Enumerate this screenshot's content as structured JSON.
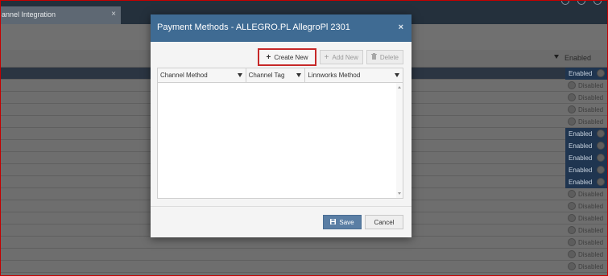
{
  "app": {
    "tab_label": "annel Integration",
    "tab_close": "×"
  },
  "background": {
    "enabled_header": "Enabled",
    "rows": [
      {
        "status": "Enabled",
        "on": true,
        "highlight": true
      },
      {
        "status": "Disabled",
        "on": false,
        "highlight": false
      },
      {
        "status": "Disabled",
        "on": false,
        "highlight": false
      },
      {
        "status": "Disabled",
        "on": false,
        "highlight": false
      },
      {
        "status": "Disabled",
        "on": false,
        "highlight": false
      },
      {
        "status": "Enabled",
        "on": true,
        "highlight": false
      },
      {
        "status": "Enabled",
        "on": true,
        "highlight": false
      },
      {
        "status": "Enabled",
        "on": true,
        "highlight": false
      },
      {
        "status": "Enabled",
        "on": true,
        "highlight": false
      },
      {
        "status": "Enabled",
        "on": true,
        "highlight": false
      },
      {
        "status": "Disabled",
        "on": false,
        "highlight": false
      },
      {
        "status": "Disabled",
        "on": false,
        "highlight": false
      },
      {
        "status": "Disabled",
        "on": false,
        "highlight": false
      },
      {
        "status": "Disabled",
        "on": false,
        "highlight": false
      },
      {
        "status": "Disabled",
        "on": false,
        "highlight": false
      },
      {
        "status": "Disabled",
        "on": false,
        "highlight": false
      },
      {
        "status": "Disabled",
        "on": false,
        "highlight": false
      }
    ]
  },
  "modal": {
    "title": "Payment Methods - ALLEGRO.PL AllegroPl 2301",
    "close": "×",
    "toolbar": {
      "create_new": "Create New",
      "add_new": "Add New",
      "delete": "Delete"
    },
    "grid": {
      "columns": [
        "Channel Method",
        "Channel Tag",
        "Linnworks Method"
      ]
    },
    "footer": {
      "save": "Save",
      "cancel": "Cancel"
    }
  }
}
